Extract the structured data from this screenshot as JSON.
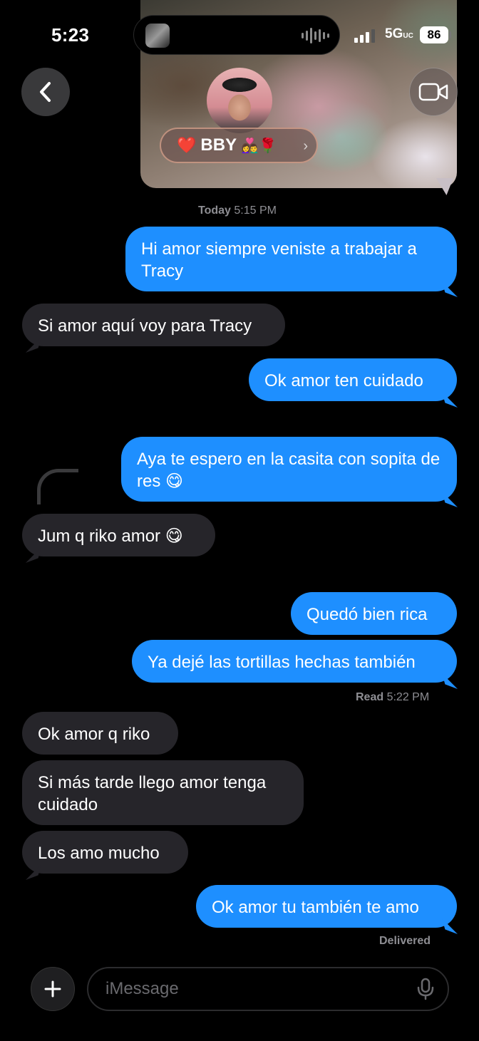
{
  "status_bar": {
    "time": "5:23",
    "network": "5G",
    "network_suffix": "UC",
    "battery": "86"
  },
  "header": {
    "contact_name": "BBY",
    "name_prefix_emoji": "❤️",
    "name_suffix_emoji": "👩‍❤️‍👨🌹",
    "back_icon": "chevron-left-icon",
    "video_icon": "video-camera-icon"
  },
  "timestamp": {
    "day": "Today",
    "time": "5:15 PM"
  },
  "messages": [
    {
      "from": "me",
      "text": "Hi amor siempre veniste a trabajar a Tracy"
    },
    {
      "from": "them",
      "text": "Si amor aquí voy para Tracy"
    },
    {
      "from": "me",
      "text": "Ok amor ten cuidado"
    },
    {
      "from": "me",
      "text": "Aya te espero en la casita con sopita de res 😋"
    },
    {
      "from": "them",
      "text": "Jum q riko amor 😋"
    },
    {
      "from": "me",
      "text": "Quedó bien rica"
    },
    {
      "from": "me",
      "text": "Ya dejé las tortillas hechas también"
    },
    {
      "from": "them",
      "text": "Ok amor q riko"
    },
    {
      "from": "them",
      "text": "Si más tarde llego amor tenga cuidado"
    },
    {
      "from": "them",
      "text": "Los amo mucho"
    },
    {
      "from": "me",
      "text": "Ok amor tu también te amo"
    }
  ],
  "receipts": {
    "read_label": "Read",
    "read_time": "5:22 PM",
    "delivered": "Delivered"
  },
  "composer": {
    "placeholder": "iMessage",
    "plus_icon": "plus-icon",
    "mic_icon": "microphone-icon"
  },
  "colors": {
    "sent_bubble": "#1e8fff",
    "received_bubble": "#26252a",
    "background": "#000000"
  }
}
